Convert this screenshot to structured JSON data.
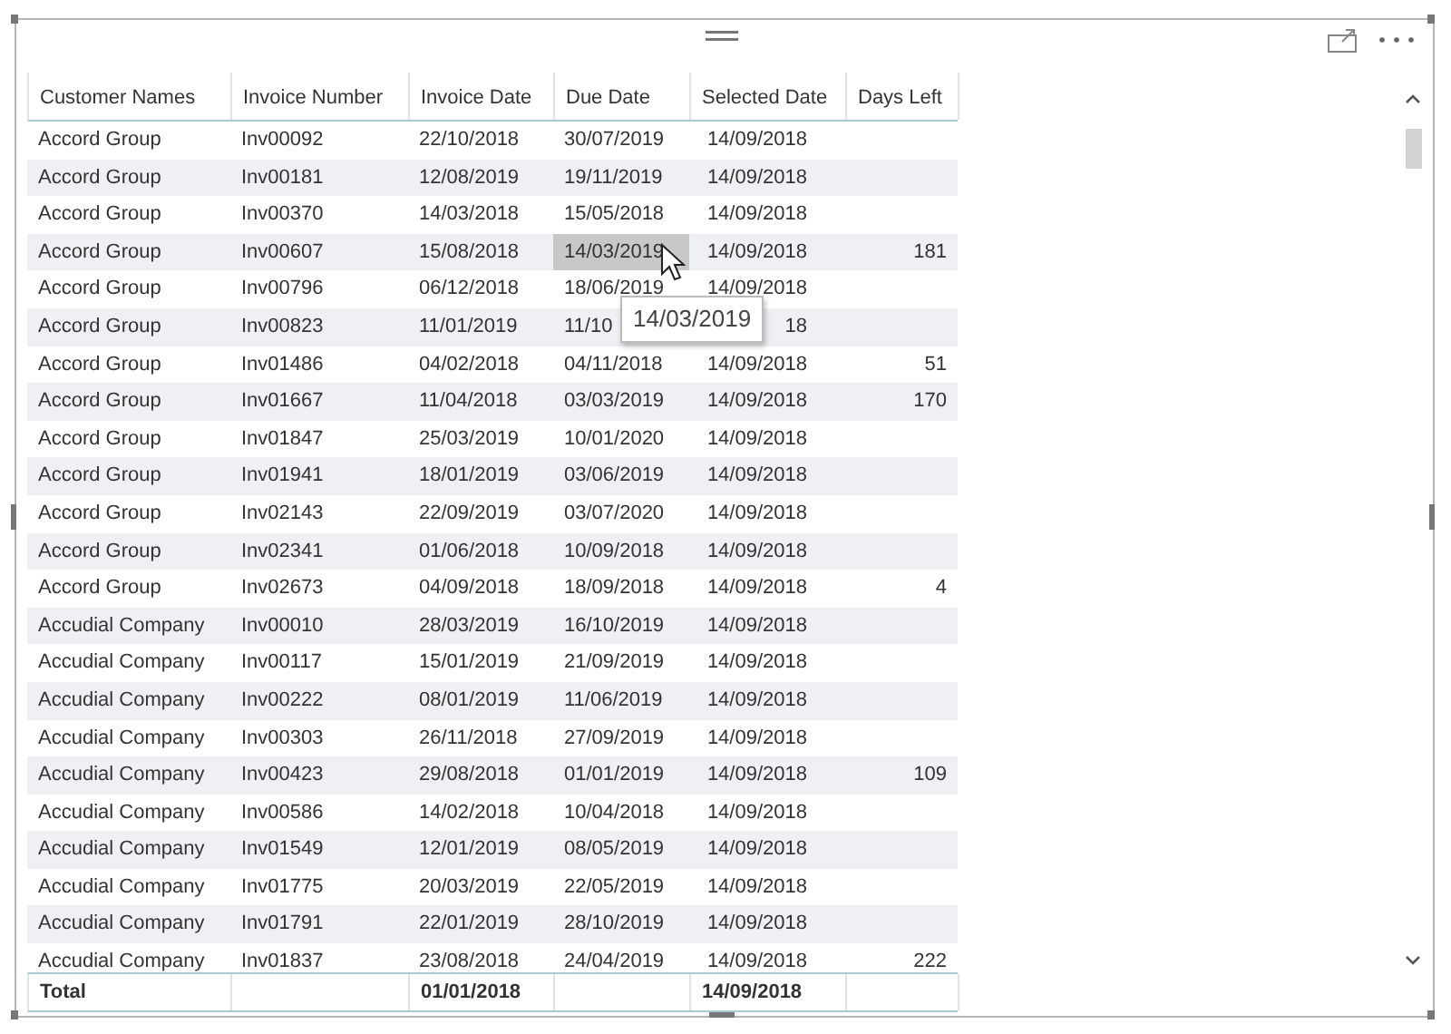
{
  "table": {
    "columns": [
      "Customer Names",
      "Invoice Number",
      "Invoice Date",
      "Due Date",
      "Selected Date",
      "Days Left"
    ],
    "rows": [
      {
        "customer": "Accord Group",
        "invoice": "Inv00092",
        "invoice_date": "22/10/2018",
        "due_date": "30/07/2019",
        "selected_date": "14/09/2018",
        "due_highlighted": false
      },
      {
        "customer": "Accord Group",
        "invoice": "Inv00181",
        "invoice_date": "12/08/2019",
        "due_date": "19/11/2019",
        "selected_date": "14/09/2018",
        "due_highlighted": false
      },
      {
        "customer": "Accord Group",
        "invoice": "Inv00370",
        "invoice_date": "14/03/2018",
        "due_date": "15/05/2018",
        "selected_date": "14/09/2018",
        "due_highlighted": false
      },
      {
        "customer": "Accord Group",
        "invoice": "Inv00607",
        "invoice_date": "15/08/2018",
        "due_date": "14/03/2019",
        "selected_date": "14/09/2018",
        "days_left": "181",
        "due_highlighted": true
      },
      {
        "customer": "Accord Group",
        "invoice": "Inv00796",
        "invoice_date": "06/12/2018",
        "due_date": "18/06/2019",
        "selected_date": "14/09/2018",
        "due_highlighted": false
      },
      {
        "customer": "Accord Group",
        "invoice": "Inv00823",
        "invoice_date": "11/01/2019",
        "due_date": "11/10",
        "selected_date": "18",
        "due_highlighted": false
      },
      {
        "customer": "Accord Group",
        "invoice": "Inv01486",
        "invoice_date": "04/02/2018",
        "due_date": "04/11/2018",
        "selected_date": "14/09/2018",
        "days_left": "51",
        "due_highlighted": false
      },
      {
        "customer": "Accord Group",
        "invoice": "Inv01667",
        "invoice_date": "11/04/2018",
        "due_date": "03/03/2019",
        "selected_date": "14/09/2018",
        "days_left": "170",
        "due_highlighted": false
      },
      {
        "customer": "Accord Group",
        "invoice": "Inv01847",
        "invoice_date": "25/03/2019",
        "due_date": "10/01/2020",
        "selected_date": "14/09/2018",
        "due_highlighted": false
      },
      {
        "customer": "Accord Group",
        "invoice": "Inv01941",
        "invoice_date": "18/01/2019",
        "due_date": "03/06/2019",
        "selected_date": "14/09/2018",
        "due_highlighted": false
      },
      {
        "customer": "Accord Group",
        "invoice": "Inv02143",
        "invoice_date": "22/09/2019",
        "due_date": "03/07/2020",
        "selected_date": "14/09/2018",
        "due_highlighted": false
      },
      {
        "customer": "Accord Group",
        "invoice": "Inv02341",
        "invoice_date": "01/06/2018",
        "due_date": "10/09/2018",
        "selected_date": "14/09/2018",
        "due_highlighted": false
      },
      {
        "customer": "Accord Group",
        "invoice": "Inv02673",
        "invoice_date": "04/09/2018",
        "due_date": "18/09/2018",
        "selected_date": "14/09/2018",
        "days_left": "4",
        "due_highlighted": false
      },
      {
        "customer": "Accudial Company",
        "invoice": "Inv00010",
        "invoice_date": "28/03/2019",
        "due_date": "16/10/2019",
        "selected_date": "14/09/2018",
        "due_highlighted": false
      },
      {
        "customer": "Accudial Company",
        "invoice": "Inv00117",
        "invoice_date": "15/01/2019",
        "due_date": "21/09/2019",
        "selected_date": "14/09/2018",
        "due_highlighted": false
      },
      {
        "customer": "Accudial Company",
        "invoice": "Inv00222",
        "invoice_date": "08/01/2019",
        "due_date": "11/06/2019",
        "selected_date": "14/09/2018",
        "due_highlighted": false
      },
      {
        "customer": "Accudial Company",
        "invoice": "Inv00303",
        "invoice_date": "26/11/2018",
        "due_date": "27/09/2019",
        "selected_date": "14/09/2018",
        "due_highlighted": false
      },
      {
        "customer": "Accudial Company",
        "invoice": "Inv00423",
        "invoice_date": "29/08/2018",
        "due_date": "01/01/2019",
        "selected_date": "14/09/2018",
        "days_left": "109",
        "due_highlighted": false
      },
      {
        "customer": "Accudial Company",
        "invoice": "Inv00586",
        "invoice_date": "14/02/2018",
        "due_date": "10/04/2018",
        "selected_date": "14/09/2018",
        "due_highlighted": false
      },
      {
        "customer": "Accudial Company",
        "invoice": "Inv01549",
        "invoice_date": "12/01/2019",
        "due_date": "08/05/2019",
        "selected_date": "14/09/2018",
        "due_highlighted": false
      },
      {
        "customer": "Accudial Company",
        "invoice": "Inv01775",
        "invoice_date": "20/03/2019",
        "due_date": "22/05/2019",
        "selected_date": "14/09/2018",
        "due_highlighted": false
      },
      {
        "customer": "Accudial Company",
        "invoice": "Inv01791",
        "invoice_date": "22/01/2019",
        "due_date": "28/10/2019",
        "selected_date": "14/09/2018",
        "due_highlighted": false
      },
      {
        "customer": "Accudial Company",
        "invoice": "Inv01837",
        "invoice_date": "23/08/2018",
        "due_date": "24/04/2019",
        "selected_date": "14/09/2018",
        "days_left": "222",
        "due_highlighted": false
      }
    ],
    "total": {
      "label": "Total",
      "invoice_date": "01/01/2018",
      "selected_date": "14/09/2018"
    }
  },
  "tooltip": {
    "text": "14/03/2019"
  }
}
